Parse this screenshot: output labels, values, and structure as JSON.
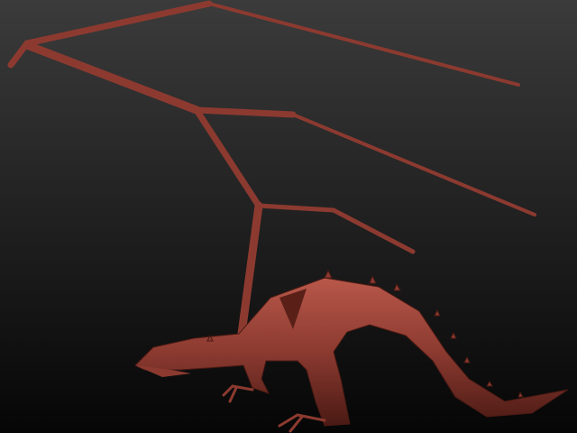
{
  "viewport": {
    "background_top": "#3b3b3b",
    "background_bottom": "#060606"
  },
  "model": {
    "base_color": "#8c3a30",
    "highlight_color": "#b8584a",
    "shadow_color": "#4a1a14"
  }
}
